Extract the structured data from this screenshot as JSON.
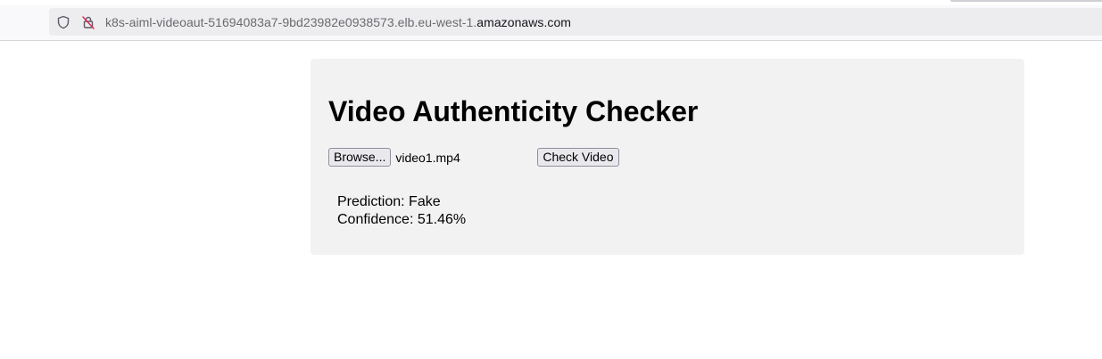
{
  "browser": {
    "url_prefix": "k8s-aiml-videoaut-51694083a7-9bd23982e0938573.elb.eu-west-1.",
    "url_domain": "amazonaws.com",
    "icons": [
      "shield-icon",
      "insecure-lock-icon"
    ]
  },
  "app": {
    "title": "Video Authenticity Checker",
    "browse_label": "Browse...",
    "selected_file": "video1.mp4",
    "check_label": "Check Video",
    "prediction_text": "Prediction: Fake",
    "confidence_text": "Confidence: 51.46%"
  },
  "colors": {
    "card_background": "#f2f2f2",
    "button_background": "#e9e9ed",
    "button_border": "#8f8f9d",
    "url_bar_background": "#ededf0"
  }
}
